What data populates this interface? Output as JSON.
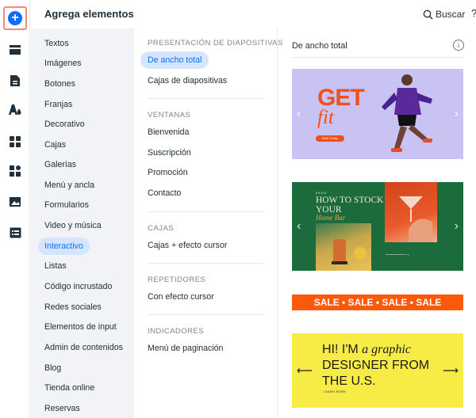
{
  "rail": {
    "items": [
      {
        "name": "add-elements",
        "icon": "plus-circle-icon"
      },
      {
        "name": "sections",
        "icon": "sections-icon"
      },
      {
        "name": "pages",
        "icon": "page-icon"
      },
      {
        "name": "design",
        "icon": "theme-icon"
      },
      {
        "name": "apps",
        "icon": "apps-grid-icon"
      },
      {
        "name": "business",
        "icon": "puzzle-icon"
      },
      {
        "name": "media",
        "icon": "image-icon"
      },
      {
        "name": "cms",
        "icon": "table-icon"
      }
    ]
  },
  "header": {
    "title": "Agrega elementos",
    "search_label": "Buscar",
    "help_label": "?",
    "close_label": "✕"
  },
  "categories": [
    "Textos",
    "Imágenes",
    "Botones",
    "Franjas",
    "Decorativo",
    "Cajas",
    "Galerías",
    "Menú y ancla",
    "Formularios",
    "Video y música",
    "Interactivo",
    "Listas",
    "Código incrustado",
    "Redes sociales",
    "Elementos de input",
    "Admin de contenidos",
    "Blog",
    "Tienda online",
    "Reservas"
  ],
  "active_category": "Interactivo",
  "sections": [
    {
      "heading": "PRESENTACIÓN DE DIAPOSITIVAS",
      "items": [
        "De ancho total",
        "Cajas de diapositivas"
      ]
    },
    {
      "heading": "VENTANAS",
      "items": [
        "Bienvenida",
        "Suscripción",
        "Promoción",
        "Contacto"
      ]
    },
    {
      "heading": "CAJAS",
      "items": [
        "Cajas + efecto cursor"
      ]
    },
    {
      "heading": "REPETIDORES",
      "items": [
        "Con efecto cursor"
      ]
    },
    {
      "heading": "INDICADORES",
      "items": [
        "Menú de paginación"
      ]
    }
  ],
  "active_item": "De ancho total",
  "preview": {
    "title": "De ancho total",
    "info": "i",
    "card1": {
      "headline": "GET",
      "subline": "fit",
      "button": "Start Today"
    },
    "card2": {
      "kicker": "ENJOY",
      "headline": "HOW TO STOCK YOUR",
      "subline": "Home Bar",
      "arrow": "————→"
    },
    "card3": {
      "text": "SALE • SALE • SALE • SALE"
    },
    "card4": {
      "line1": "HI! I'M ",
      "line1_italic": "a graphic",
      "line2": "DESIGNER FROM THE U.S.",
      "cta": "LEARN MORE"
    },
    "arrows": {
      "left": "‹",
      "right": "›",
      "left_long": "⟵",
      "right_long": "⟶"
    }
  },
  "colors": {
    "accent": "#116dff",
    "active_bg": "#d6e5ff",
    "highlight_border": "#f18b7d",
    "sale_orange": "#fb5a0d",
    "yellow": "#f6ec45",
    "green": "#1c6b3c",
    "lavender": "#c9c3f3"
  }
}
